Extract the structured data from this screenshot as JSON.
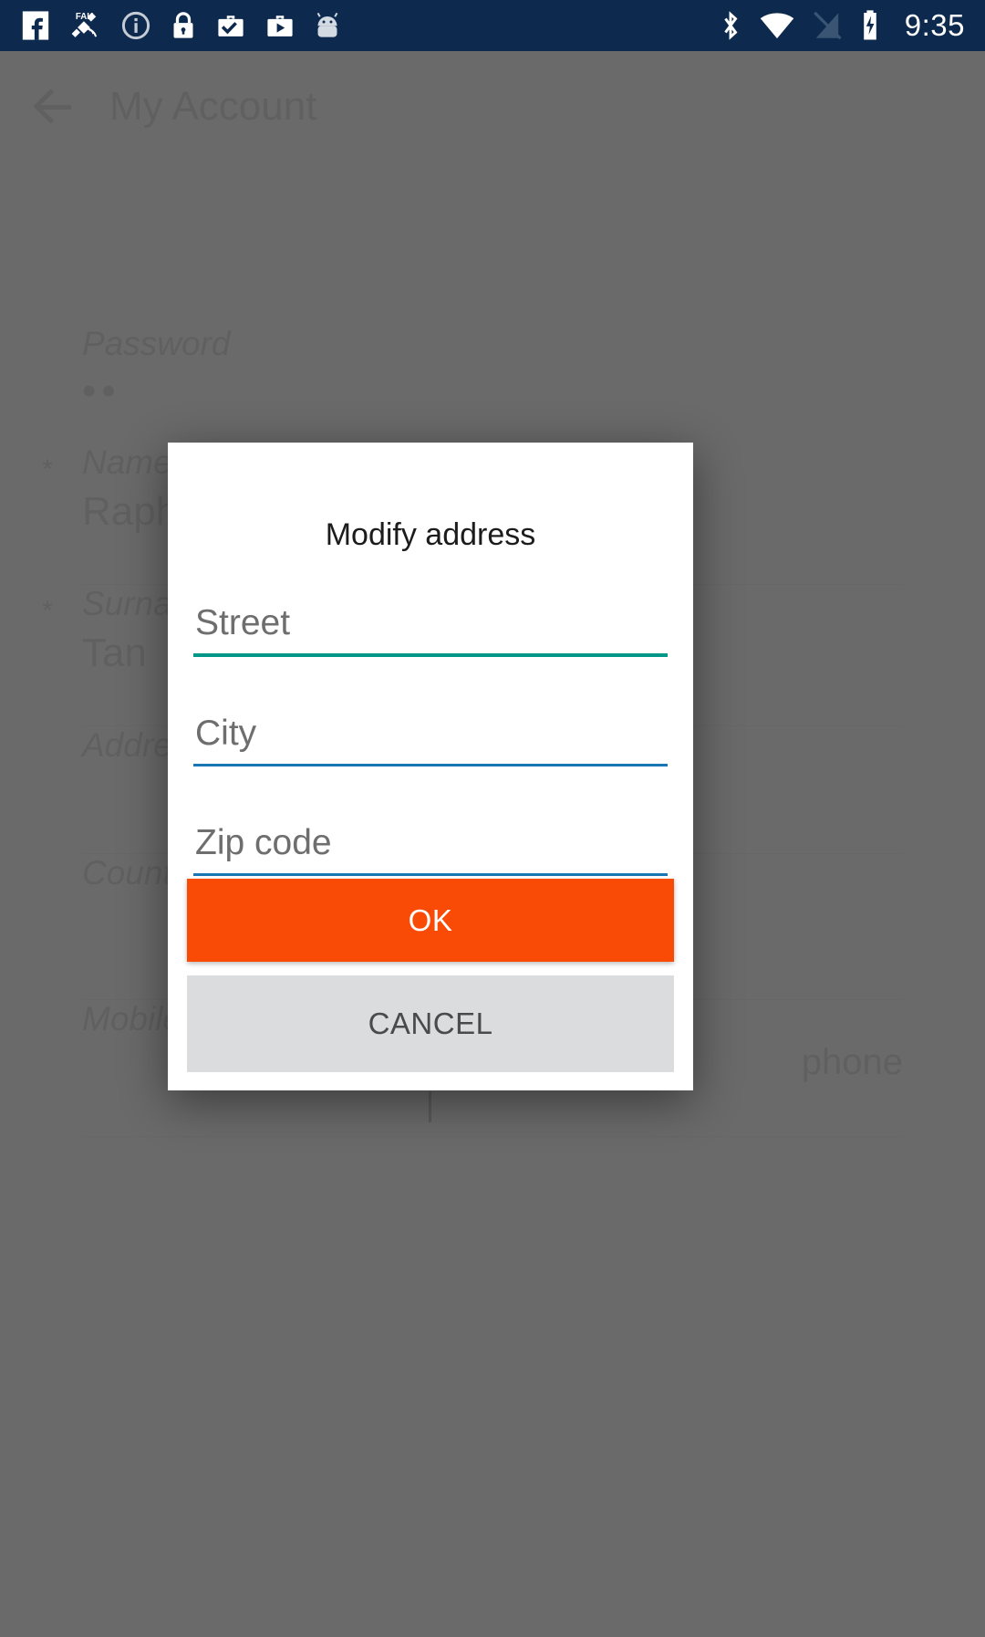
{
  "status_bar": {
    "background_color": "#0d2a4e",
    "clock": "9:35",
    "left_icons": [
      {
        "name": "facebook-icon",
        "label": "Facebook"
      },
      {
        "name": "fake-gps-satellite-icon",
        "label": "FAKE GPS"
      },
      {
        "name": "info-circle-icon",
        "label": "Info"
      },
      {
        "name": "lock-icon",
        "label": "Screen lock"
      },
      {
        "name": "work-profile-check-icon",
        "label": "Work briefcase check"
      },
      {
        "name": "work-profile-play-icon",
        "label": "Work briefcase play"
      },
      {
        "name": "android-head-icon",
        "label": "Android"
      }
    ],
    "right_icons": [
      {
        "name": "bluetooth-icon",
        "label": "Bluetooth"
      },
      {
        "name": "wifi-icon",
        "label": "Wi-Fi"
      },
      {
        "name": "no-sim-signal-icon",
        "label": "No signal"
      },
      {
        "name": "battery-charging-icon",
        "label": "Battery charging"
      }
    ]
  },
  "background_screen": {
    "app_title": "My Account",
    "back_icon": "back-arrow-icon",
    "password_label": "Password",
    "password_value": "••",
    "rows": [
      {
        "required": "*",
        "label": "Name",
        "value": "Raphael",
        "right": ""
      },
      {
        "required": "*",
        "label": "Surname",
        "value": "Tan",
        "right": ""
      },
      {
        "required": "",
        "label": "Address",
        "value": "",
        "right": ""
      },
      {
        "required": "",
        "label": "Country",
        "value": "",
        "right": ""
      },
      {
        "required": "",
        "label": "Mobile",
        "value": "",
        "right": "phone"
      }
    ]
  },
  "dialog": {
    "title": "Modify address",
    "fields": [
      {
        "name": "street",
        "placeholder": "Street",
        "value": "",
        "focused": true,
        "underline_color": "#009688"
      },
      {
        "name": "city",
        "placeholder": "City",
        "value": "",
        "focused": false,
        "underline_color": "#1976b5"
      },
      {
        "name": "zip",
        "placeholder": "Zip code",
        "value": "",
        "focused": false,
        "underline_color": "#1976b5"
      }
    ],
    "buttons": {
      "ok_label": "OK",
      "ok_color": "#f94b05",
      "cancel_label": "CANCEL",
      "cancel_color": "#dadcde"
    }
  }
}
